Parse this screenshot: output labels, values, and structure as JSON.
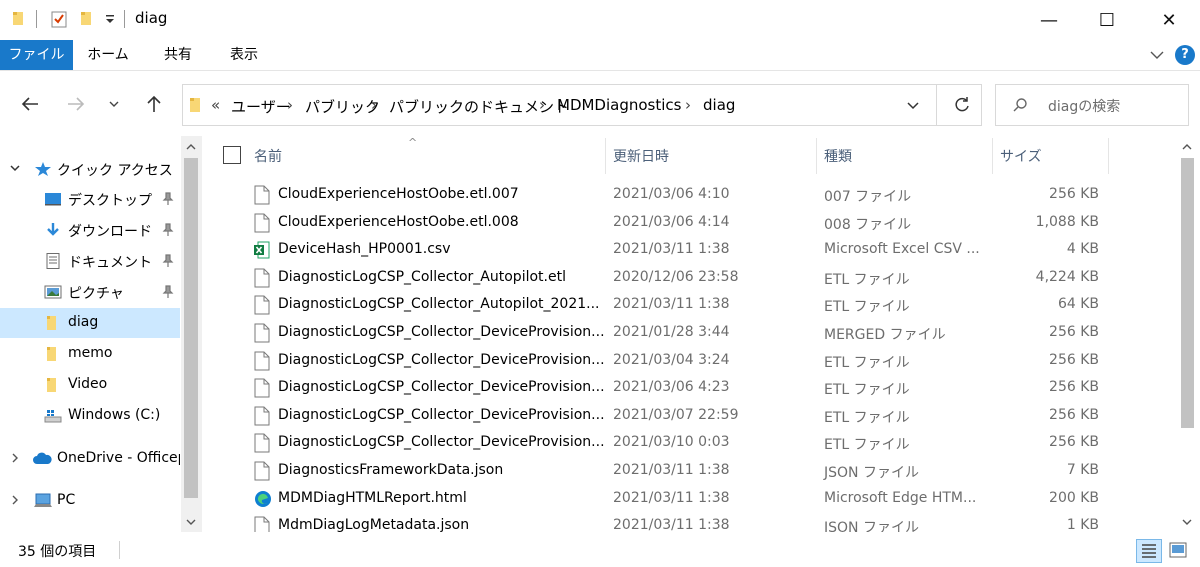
{
  "window": {
    "title": "diag",
    "minimize": "—",
    "maximize": "☐",
    "close": "✕"
  },
  "ribbon": {
    "tabs": [
      "ファイル",
      "ホーム",
      "共有",
      "表示"
    ],
    "help": "?"
  },
  "nav": {
    "crumb_overflow": "«",
    "breadcrumbs": [
      "ユーザー",
      "パブリック",
      "パブリックのドキュメント",
      "MDMDiagnostics",
      "diag"
    ],
    "search_placeholder": "diagの検索"
  },
  "sidebar": {
    "items": [
      {
        "label": "クイック アクセス",
        "icon": "star-icon",
        "pinned": false,
        "selected": false
      },
      {
        "label": "デスクトップ",
        "icon": "desktop-icon",
        "pinned": true,
        "selected": false
      },
      {
        "label": "ダウンロード",
        "icon": "download-icon",
        "pinned": true,
        "selected": false
      },
      {
        "label": "ドキュメント",
        "icon": "document-icon",
        "pinned": true,
        "selected": false
      },
      {
        "label": "ピクチャ",
        "icon": "pictures-icon",
        "pinned": true,
        "selected": false
      },
      {
        "label": "diag",
        "icon": "folder-icon",
        "pinned": false,
        "selected": true
      },
      {
        "label": "memo",
        "icon": "folder-icon",
        "pinned": false,
        "selected": false
      },
      {
        "label": "Video",
        "icon": "folder-icon",
        "pinned": false,
        "selected": false
      },
      {
        "label": "Windows  (C:)",
        "icon": "drive-icon",
        "pinned": false,
        "selected": false
      },
      {
        "label": "OneDrive - Officep",
        "icon": "cloud-icon",
        "pinned": false,
        "selected": false
      },
      {
        "label": "PC",
        "icon": "pc-icon",
        "pinned": false,
        "selected": false
      }
    ]
  },
  "columns": {
    "name": "名前",
    "date": "更新日時",
    "type": "種類",
    "size": "サイズ",
    "sort_indicator": "^"
  },
  "files": [
    {
      "name": "CloudExperienceHostOobe.etl.007",
      "date": "2021/03/06 4:10",
      "type": "007 ファイル",
      "size": "256 KB",
      "icon": "file-icon"
    },
    {
      "name": "CloudExperienceHostOobe.etl.008",
      "date": "2021/03/06 4:14",
      "type": "008 ファイル",
      "size": "1,088 KB",
      "icon": "file-icon"
    },
    {
      "name": "DeviceHash_HP0001.csv",
      "date": "2021/03/11 1:38",
      "type": "Microsoft Excel CSV ...",
      "size": "4 KB",
      "icon": "excel-icon"
    },
    {
      "name": "DiagnosticLogCSP_Collector_Autopilot.etl",
      "date": "2020/12/06 23:58",
      "type": "ETL ファイル",
      "size": "4,224 KB",
      "icon": "file-icon"
    },
    {
      "name": "DiagnosticLogCSP_Collector_Autopilot_2021...",
      "date": "2021/03/11 1:38",
      "type": "ETL ファイル",
      "size": "64 KB",
      "icon": "file-icon"
    },
    {
      "name": "DiagnosticLogCSP_Collector_DeviceProvision...",
      "date": "2021/01/28 3:44",
      "type": "MERGED ファイル",
      "size": "256 KB",
      "icon": "file-icon"
    },
    {
      "name": "DiagnosticLogCSP_Collector_DeviceProvision...",
      "date": "2021/03/04 3:24",
      "type": "ETL ファイル",
      "size": "256 KB",
      "icon": "file-icon"
    },
    {
      "name": "DiagnosticLogCSP_Collector_DeviceProvision...",
      "date": "2021/03/06 4:23",
      "type": "ETL ファイル",
      "size": "256 KB",
      "icon": "file-icon"
    },
    {
      "name": "DiagnosticLogCSP_Collector_DeviceProvision...",
      "date": "2021/03/07 22:59",
      "type": "ETL ファイル",
      "size": "256 KB",
      "icon": "file-icon"
    },
    {
      "name": "DiagnosticLogCSP_Collector_DeviceProvision...",
      "date": "2021/03/10 0:03",
      "type": "ETL ファイル",
      "size": "256 KB",
      "icon": "file-icon"
    },
    {
      "name": "DiagnosticsFrameworkData.json",
      "date": "2021/03/11 1:38",
      "type": "JSON ファイル",
      "size": "7 KB",
      "icon": "file-icon"
    },
    {
      "name": "MDMDiagHTMLReport.html",
      "date": "2021/03/11 1:38",
      "type": "Microsoft Edge HTM...",
      "size": "200 KB",
      "icon": "edge-icon"
    },
    {
      "name": "MdmDiagLogMetadata.json",
      "date": "2021/03/11 1:38",
      "type": "JSON ファイル",
      "size": "1 KB",
      "icon": "file-icon"
    }
  ],
  "status": {
    "item_count": "35 個の項目"
  },
  "colors": {
    "accent": "#1979ca",
    "selection": "#cce8ff",
    "folder": "#f8d775"
  }
}
